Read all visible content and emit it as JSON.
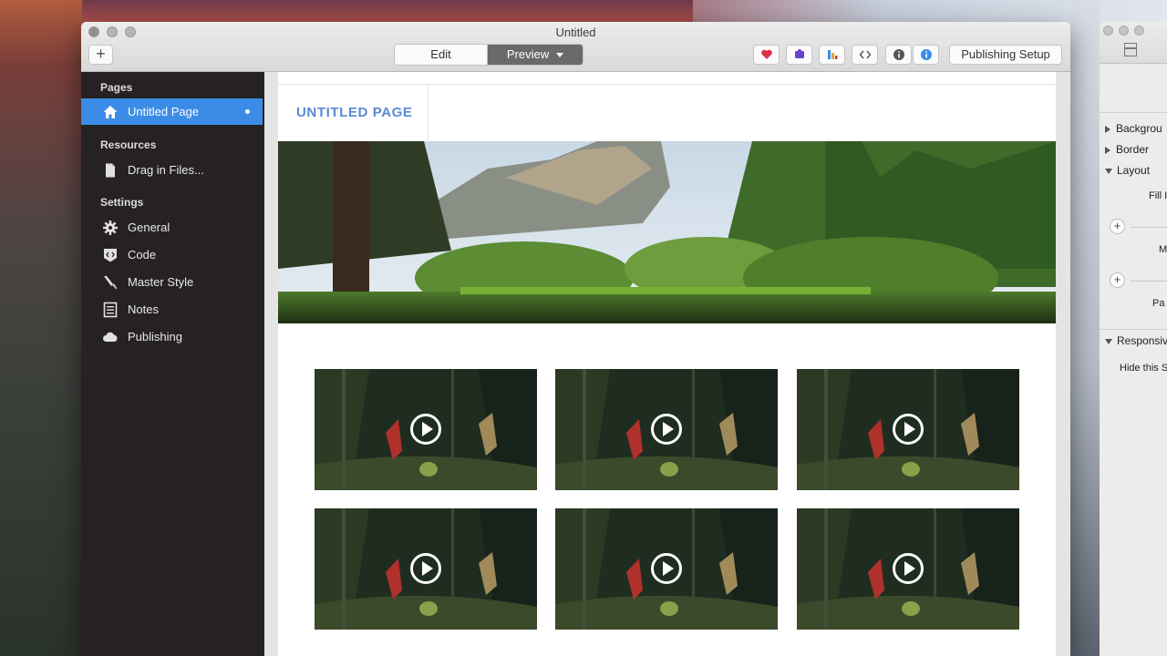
{
  "window": {
    "title": "Untitled",
    "add_label": "+",
    "segmented": {
      "edit": "Edit",
      "preview": "Preview"
    },
    "publishing_setup": "Publishing Setup",
    "toolbar_icons": [
      "heart-icon",
      "puzzle-icon",
      "theme-icon",
      "code-icon",
      "info-icon",
      "info-blue-icon"
    ]
  },
  "sidebar": {
    "pages_heading": "Pages",
    "pages": [
      {
        "label": "Untitled Page",
        "icon": "home-icon"
      }
    ],
    "resources_heading": "Resources",
    "resources": [
      {
        "label": "Drag in Files...",
        "icon": "file-icon"
      }
    ],
    "settings_heading": "Settings",
    "settings": [
      {
        "label": "General",
        "icon": "gear-icon"
      },
      {
        "label": "Code",
        "icon": "code-badge-icon"
      },
      {
        "label": "Master Style",
        "icon": "brush-icon"
      },
      {
        "label": "Notes",
        "icon": "notes-icon"
      },
      {
        "label": "Publishing",
        "icon": "cloud-icon"
      }
    ]
  },
  "canvas": {
    "page_title": "UNTITLED PAGE",
    "video_count": 6
  },
  "inspector": {
    "sections": [
      {
        "label": "Backgrou",
        "expanded": false
      },
      {
        "label": "Border",
        "expanded": false
      },
      {
        "label": "Layout",
        "expanded": true
      }
    ],
    "fill_label": "Fill I",
    "margin_label": "M",
    "padding_label": "Pa",
    "responsive_label": "Responsiv",
    "hide_label": "Hide this S"
  },
  "colors": {
    "sidebar_bg": "#262223",
    "selection": "#3b8ce6",
    "page_title": "#5b8ad3",
    "preview_active": "#6a6a6a"
  }
}
